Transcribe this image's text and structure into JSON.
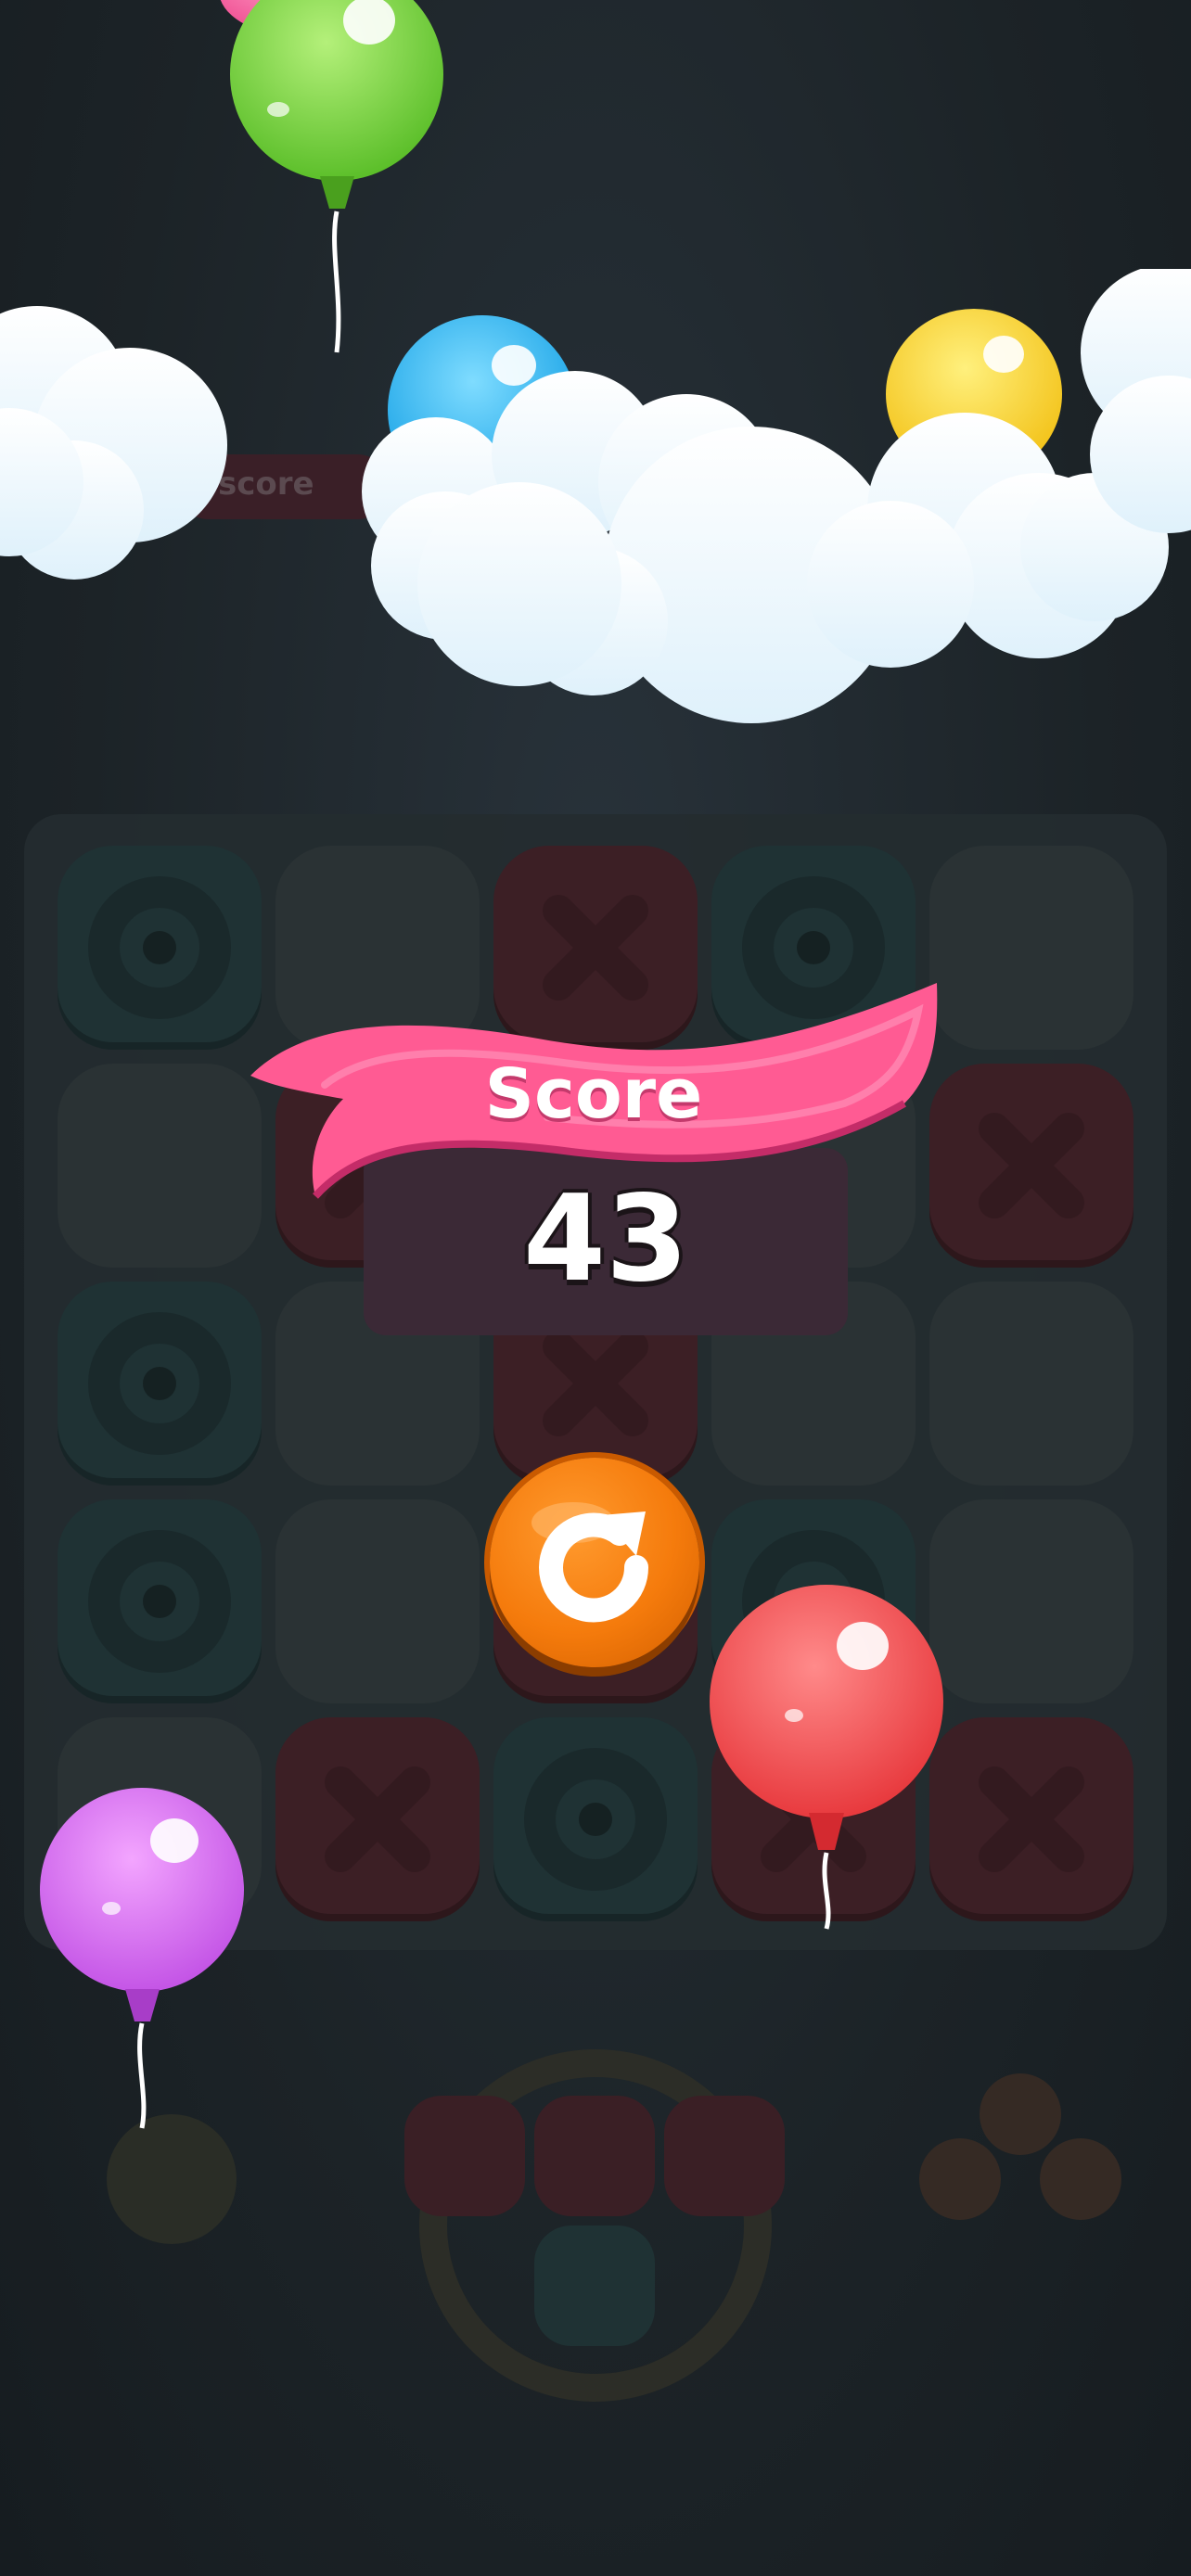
{
  "hud": {
    "best_label": "score"
  },
  "result": {
    "title": "Score",
    "score": "43"
  },
  "buttons": {
    "restart_icon": "restart-icon"
  },
  "colors": {
    "ribbon": "#ff5b93",
    "button": "#f57b0c",
    "background": "#1c2327"
  },
  "board": {
    "rows": [
      [
        "O",
        "",
        "X",
        "O",
        ""
      ],
      [
        "",
        "X",
        "",
        "",
        "X"
      ],
      [
        "O",
        "",
        "X",
        "",
        ""
      ],
      [
        "O",
        "",
        "X",
        "O",
        ""
      ],
      [
        "",
        "X",
        "O",
        "X",
        "X"
      ]
    ]
  },
  "balloons": [
    "green",
    "pink",
    "blue",
    "yellow",
    "red",
    "purple"
  ]
}
